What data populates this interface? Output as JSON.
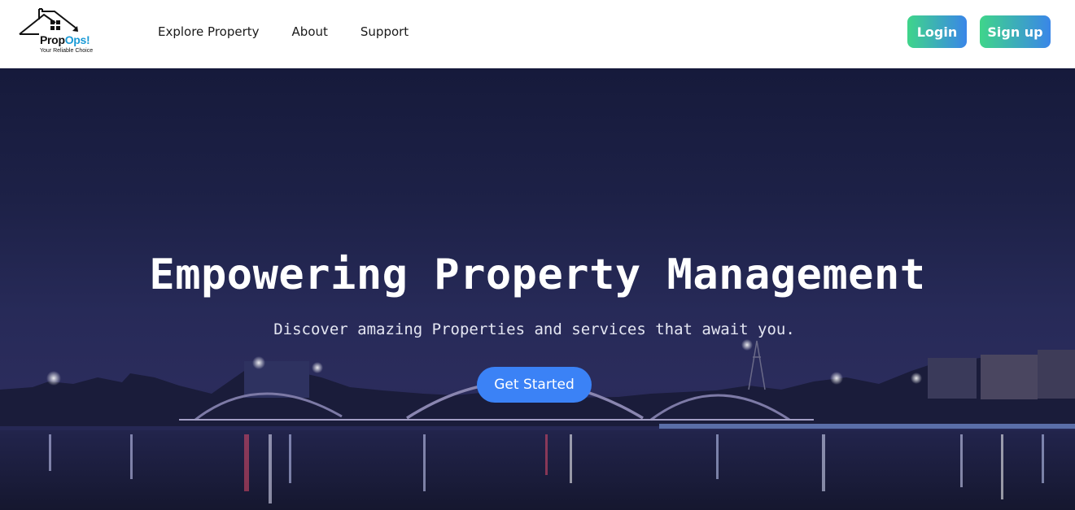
{
  "brand": {
    "name_part1": "Prop",
    "name_part2": "Ops!",
    "tagline": "Your Reliable Choice"
  },
  "nav": {
    "links": [
      "Explore Property",
      "About",
      "Support"
    ],
    "login_label": "Login",
    "signup_label": "Sign up"
  },
  "hero": {
    "title": "Empowering Property Management",
    "subtitle": "Discover amazing Properties and services that await you.",
    "cta_label": "Get Started"
  },
  "colors": {
    "button_gradient_start": "#3fd58a",
    "button_gradient_end": "#3a86e8",
    "cta_blue": "#3b82f6",
    "logo_accent": "#1a9ad6",
    "hero_night": "#1d2147"
  },
  "icons": [
    "house-logo-icon"
  ]
}
